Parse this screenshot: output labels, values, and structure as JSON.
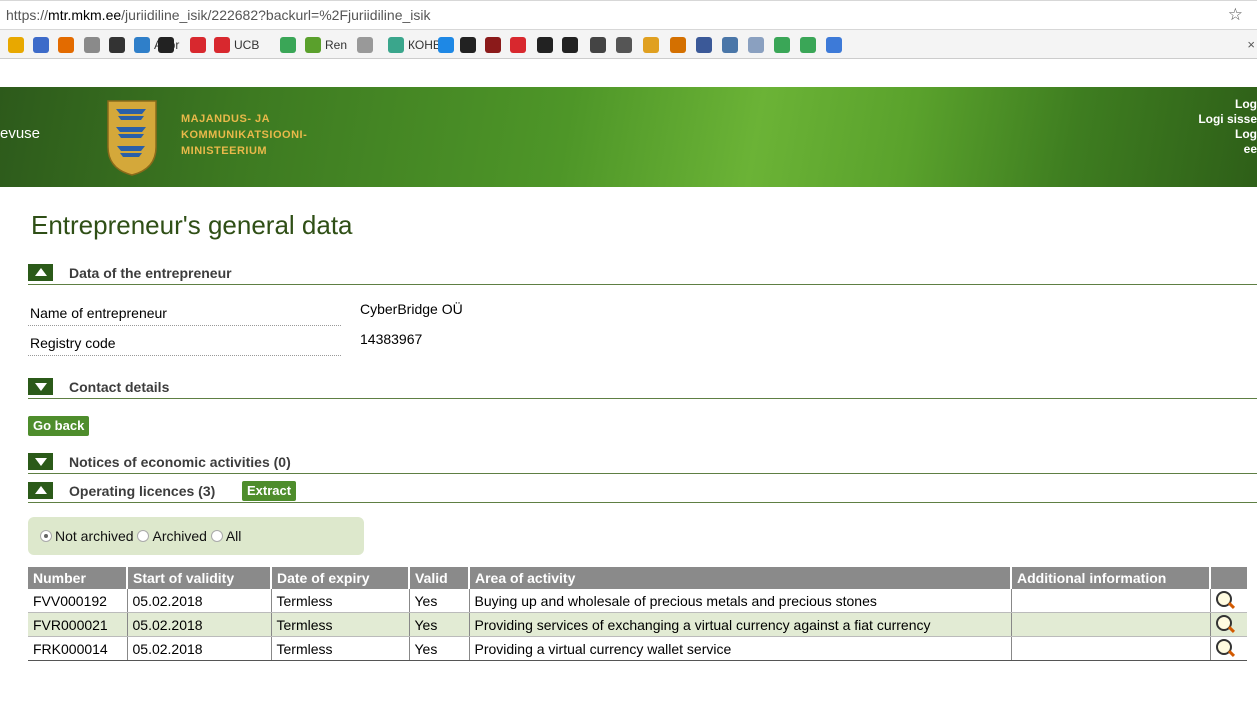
{
  "browser": {
    "url_scheme": "https://",
    "url_host": "mtr.mkm.ee",
    "url_path": "/juriidiline_isik/222682?backurl=%2Fjuriidiline_isik",
    "bookmarks": [
      {
        "label": "",
        "icon": "sunflower-icon",
        "color": "#e8a800"
      },
      {
        "label": "",
        "icon": "wp-icon",
        "color": "#3d6bc9"
      },
      {
        "label": "",
        "icon": "ud-icon",
        "color": "#e36b00"
      },
      {
        "label": "",
        "icon": "coin-icon",
        "color": "#8a8a8a"
      },
      {
        "label": "",
        "icon": "kb-icon",
        "color": "#333333"
      },
      {
        "label": "Abbr",
        "icon": "a-icon",
        "color": "#2f7fc9"
      },
      {
        "label": "",
        "icon": "emoji-icon",
        "color": "#222222"
      },
      {
        "label": "",
        "icon": "acrobat-icon",
        "color": "#d8282e"
      },
      {
        "label": "UCB",
        "icon": "ucb-icon",
        "color": "#d8282e"
      },
      {
        "label": "",
        "icon": "leaf-icon",
        "color": "#3aa657"
      },
      {
        "label": "Ren",
        "icon": "ren-icon",
        "color": "#5aa02c"
      },
      {
        "label": "",
        "icon": "page-icon",
        "color": "#999999"
      },
      {
        "label": "КОНВ",
        "icon": "konv-icon",
        "color": "#3aa68c"
      },
      {
        "label": "",
        "icon": "drop-icon",
        "color": "#1e88e5"
      },
      {
        "label": "",
        "icon": "l-icon",
        "color": "#222222"
      },
      {
        "label": "",
        "icon": "t-icon",
        "color": "#8b1a1a"
      },
      {
        "label": "",
        "icon": "forty-icon",
        "color": "#d8282e"
      },
      {
        "label": "",
        "icon": "v-icon",
        "color": "#222222"
      },
      {
        "label": "",
        "icon": "rc-icon",
        "color": "#222222"
      },
      {
        "label": "",
        "icon": "gear-face-icon",
        "color": "#444444"
      },
      {
        "label": "",
        "icon": "b-icon",
        "color": "#555555"
      },
      {
        "label": "",
        "icon": "cross-icon",
        "color": "#e0a020"
      },
      {
        "label": "",
        "icon": "person-icon",
        "color": "#d47000"
      },
      {
        "label": "",
        "icon": "facebook-icon",
        "color": "#3b5998"
      },
      {
        "label": "",
        "icon": "vk-icon",
        "color": "#4a76a8"
      },
      {
        "label": "",
        "icon": "ship-icon",
        "color": "#8aa0c0"
      },
      {
        "label": "",
        "icon": "info-icon",
        "color": "#3aa657"
      },
      {
        "label": "",
        "icon": "check-icon",
        "color": "#3aa657"
      },
      {
        "label": "",
        "icon": "puzzle-icon",
        "color": "#3d7ad8"
      }
    ],
    "bookmarks_close": "×"
  },
  "header": {
    "left_text": "evuse",
    "ministry_lines": [
      "Majandus- ja",
      "Kommunikatsiooni-",
      "ministeerium"
    ],
    "login_lines": [
      "Log",
      "Logi sisse",
      "Log",
      "ee"
    ],
    "accent_color": "#e9b94a"
  },
  "page": {
    "title": "Entrepreneur's general data",
    "sections": {
      "entrepreneur": "Data of the entrepreneur",
      "contact": "Contact details",
      "notices": "Notices of economic activities (0)",
      "licences": "Operating licences (3)"
    },
    "fields": [
      {
        "label": "Name of entrepreneur",
        "value": "CyberBridge OÜ"
      },
      {
        "label": "Registry code",
        "value": "14383967"
      }
    ],
    "go_back_label": "Go back",
    "extract_label": "Extract",
    "filter": {
      "options": [
        "Not archived",
        "Archived",
        "All"
      ],
      "selected": "Not archived"
    }
  },
  "licences_table": {
    "headers": [
      "Number",
      "Start of validity",
      "Date of expiry",
      "Valid",
      "Area of activity",
      "Additional information",
      ""
    ],
    "rows": [
      {
        "number": "FVV000192",
        "start": "05.02.2018",
        "expiry": "Termless",
        "valid": "Yes",
        "area": "Buying up and wholesale of precious metals and precious stones",
        "additional": ""
      },
      {
        "number": "FVR000021",
        "start": "05.02.2018",
        "expiry": "Termless",
        "valid": "Yes",
        "area": "Providing services of exchanging a virtual currency against a fiat currency",
        "additional": ""
      },
      {
        "number": "FRK000014",
        "start": "05.02.2018",
        "expiry": "Termless",
        "valid": "Yes",
        "area": "Providing a virtual currency wallet service",
        "additional": ""
      }
    ]
  }
}
